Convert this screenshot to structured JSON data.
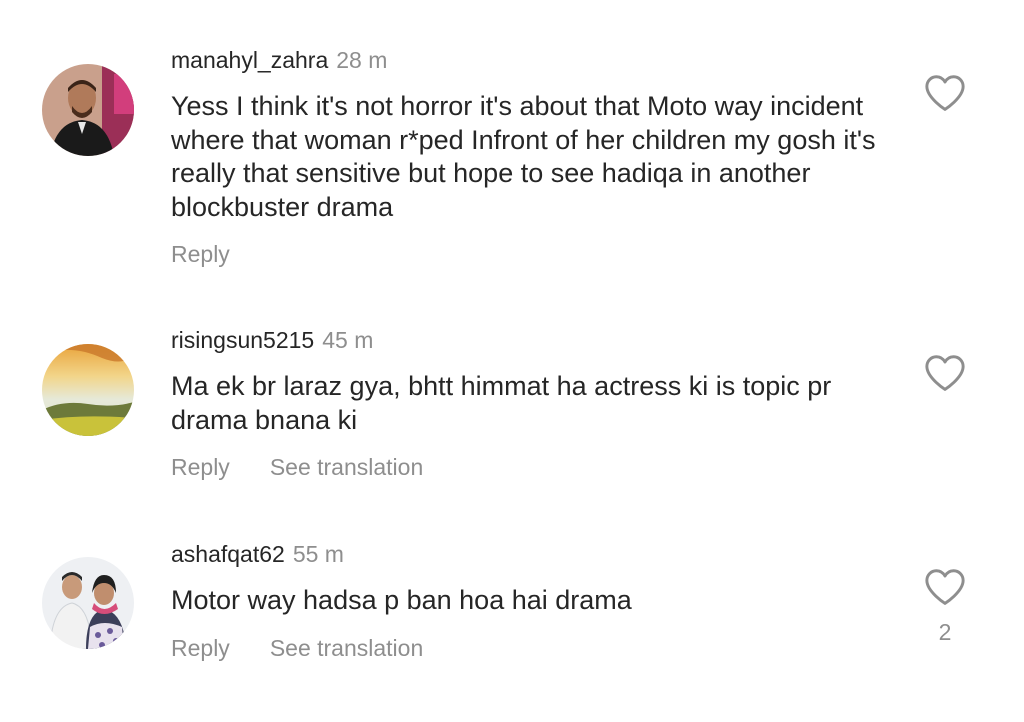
{
  "comments": [
    {
      "username": "manahyl_zahra",
      "time": "28 m",
      "text": "Yess I think it's not horror it's about that Moto way incident where that woman r*ped Infront of her children my gosh it's really that sensitive but hope to see hadiqa in another blockbuster drama",
      "reply": "Reply"
    },
    {
      "username": "risingsun5215",
      "time": "45 m",
      "text": "Ma ek br laraz gya, bhtt himmat ha actress ki is topic pr drama bnana ki",
      "reply": "Reply",
      "translate": "See translation"
    },
    {
      "username": "ashafqat62",
      "time": "55 m",
      "text": "Motor way hadsa p ban hoa hai drama",
      "reply": "Reply",
      "translate": "See translation",
      "likes": "2"
    }
  ],
  "icons": {
    "like": "heart-outline-icon"
  },
  "colors": {
    "text": "#262626",
    "secondary": "#8e8e8e",
    "background": "#ffffff"
  }
}
